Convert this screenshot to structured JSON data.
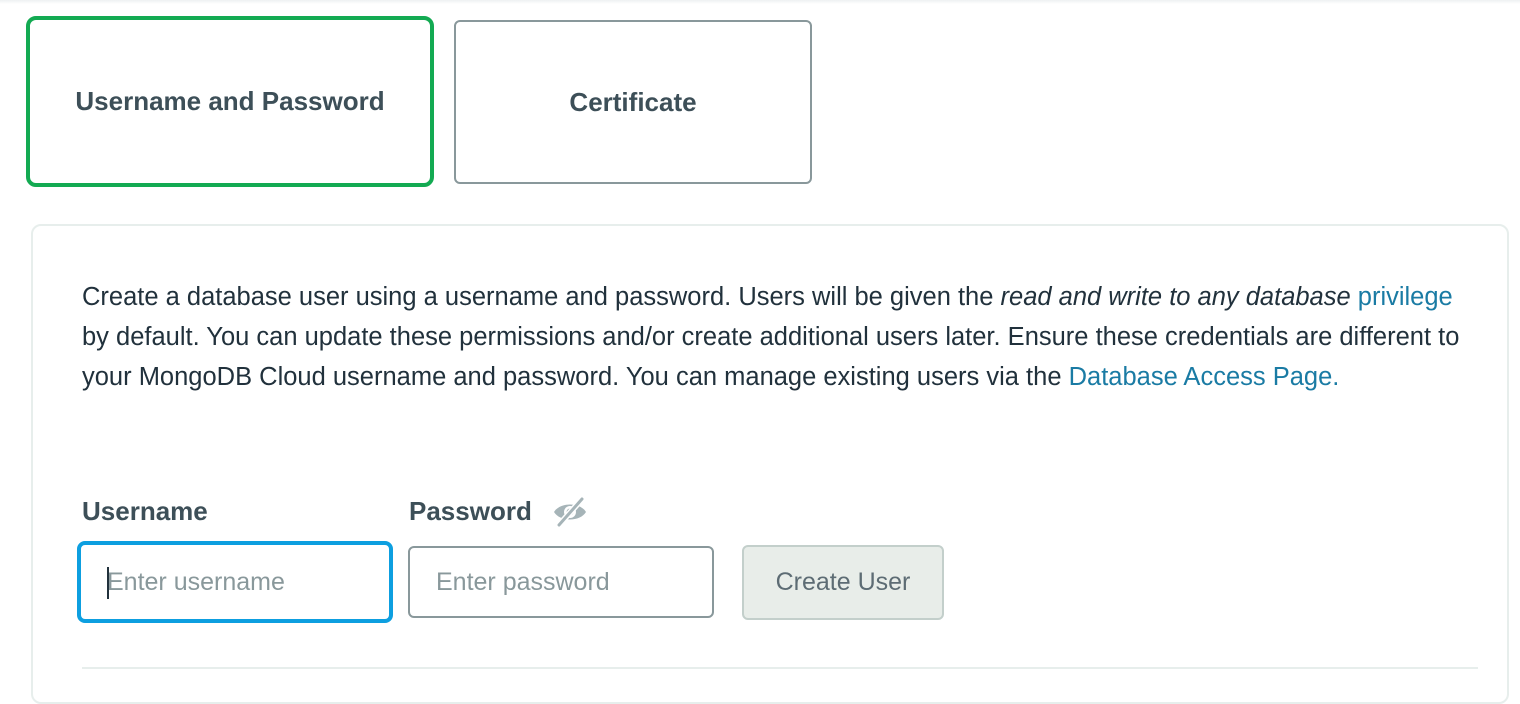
{
  "auth_methods": [
    {
      "label": "Username and Password",
      "selected": true
    },
    {
      "label": "Certificate",
      "selected": false
    }
  ],
  "description": {
    "part1": "Create a database user using a username and password. Users will be given the ",
    "italic": "read and write to any database",
    "link1": "privilege",
    "part2": " by default. You can update these permissions and/or create additional users later. Ensure these credentials are different to your MongoDB Cloud username and password. You can manage existing users via the ",
    "link2": "Database Access Page."
  },
  "form": {
    "username_label": "Username",
    "username_value": "",
    "username_placeholder": "Enter username",
    "password_label": "Password",
    "password_value": "",
    "password_placeholder": "Enter password",
    "password_visibility_icon": "eye-slash-icon",
    "create_button_label": "Create User"
  },
  "colors": {
    "selected_border": "#13aa52",
    "focus_border": "#0d9fe0",
    "link": "#1a7ba4",
    "text": "#21313c"
  }
}
